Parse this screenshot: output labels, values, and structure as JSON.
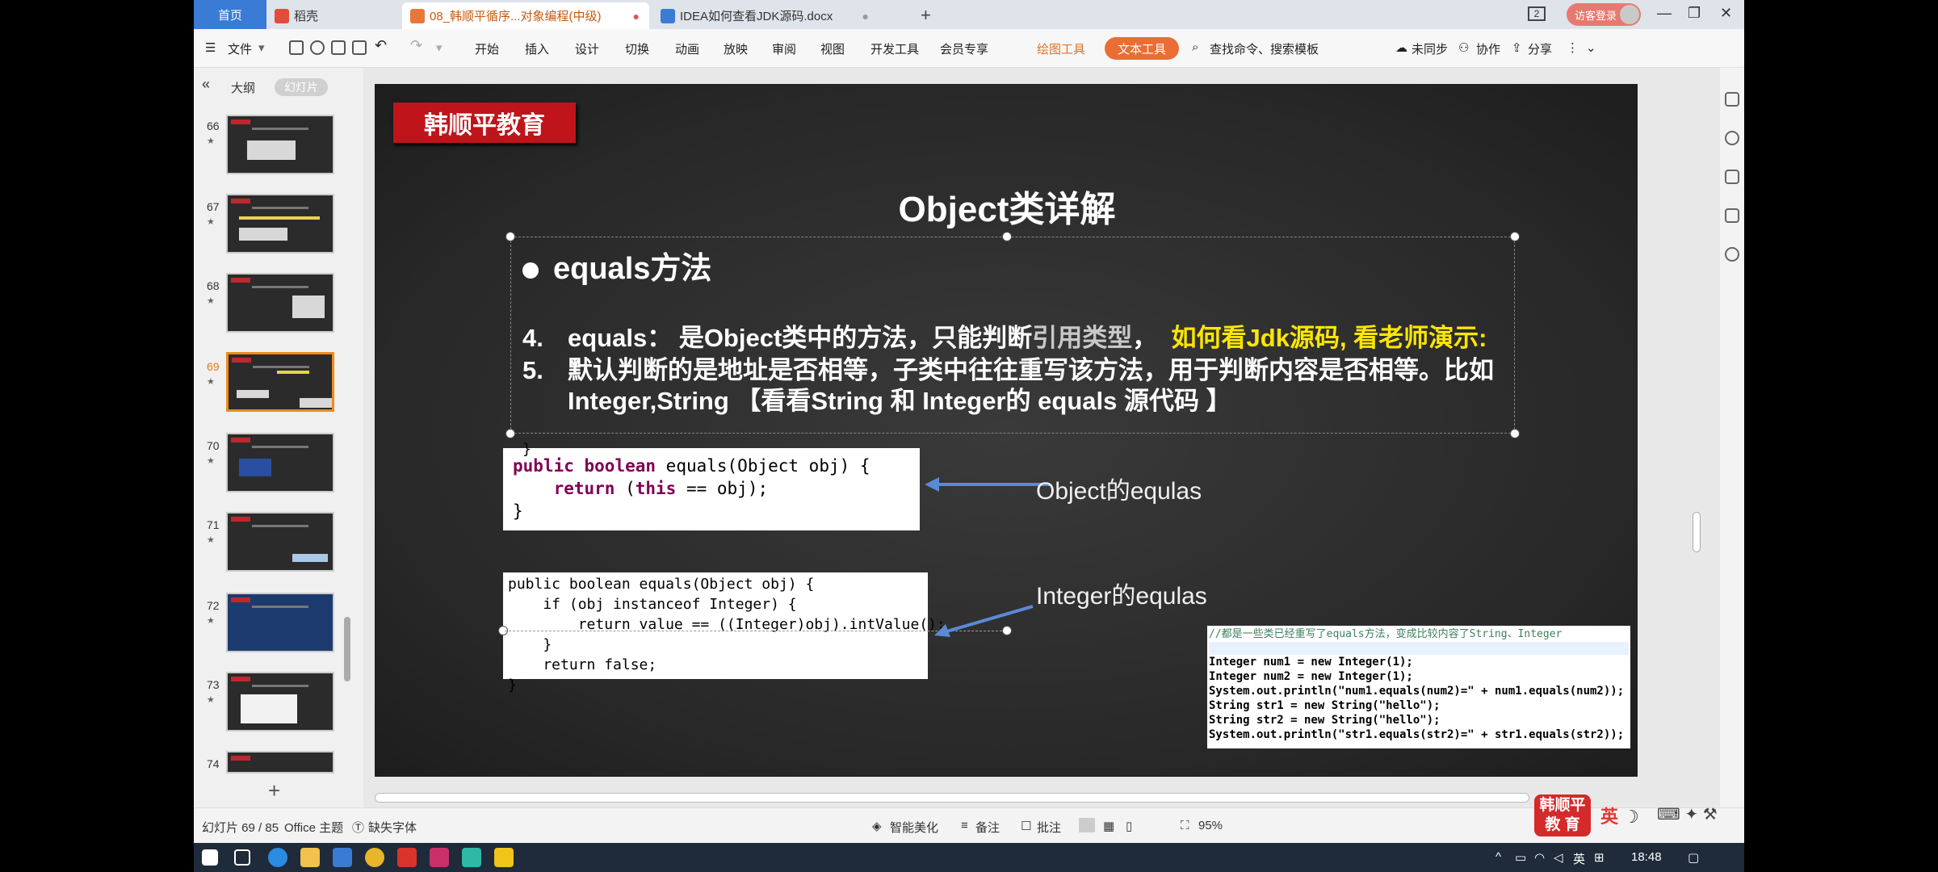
{
  "titlebar": {
    "tabs": [
      {
        "label": "首页"
      },
      {
        "label": "稻壳"
      },
      {
        "label": "08_韩顺平循序...对象编程(中级)"
      },
      {
        "label": "IDEA如何查看JDK源码.docx"
      }
    ],
    "window_count": "2",
    "login_label": "访客登录"
  },
  "menu": {
    "file": "文件",
    "items": [
      "开始",
      "插入",
      "设计",
      "切换",
      "动画",
      "放映",
      "审阅",
      "视图",
      "开发工具",
      "会员专享"
    ],
    "drawing_tool": "绘图工具",
    "text_tool": "文本工具",
    "search_placeholder": "查找命令、搜索模板",
    "sync": "未同步",
    "collab": "协作",
    "share": "分享"
  },
  "left_panel": {
    "outline_tab": "大纲",
    "slides_tab": "幻灯片",
    "thumbs": [
      {
        "num": "66"
      },
      {
        "num": "67"
      },
      {
        "num": "68"
      },
      {
        "num": "69"
      },
      {
        "num": "70"
      },
      {
        "num": "71"
      },
      {
        "num": "72"
      },
      {
        "num": "73"
      },
      {
        "num": "74"
      }
    ],
    "selected_index": 3
  },
  "slide": {
    "brand": "韩顺平教育",
    "title": "Object类详解",
    "bullet": "equals方法",
    "line4_num": "4.",
    "line4_a": "equals： 是Object类中的方法，只能判断",
    "line4_b": "引用类型",
    "line4_c": "，",
    "line4_d": "如何看Jdk源码, 看老师演示:",
    "line5_num": "5.",
    "line5_a": "默认判断的是地址是否相等，子类中往往重写该方法，用于判断内容是否相等。比如",
    "line5_b": "Integer,String 【看看String 和 Integer的 equals 源代码 】",
    "label_object": "Object的equlas",
    "label_integer": "Integer的equlas",
    "code1": {
      "l0": "}",
      "l1a": "public",
      "l1b": "boolean",
      "l1c": " equals(Object obj) {",
      "l2a": "return",
      "l2b": " (",
      "l2c": "this",
      "l2d": " == obj);",
      "l3": "}"
    },
    "code2": {
      "l1": "public boolean equals(Object obj) {",
      "l2": "    if (obj instanceof Integer) {",
      "l3": "        return value == ((Integer)obj).intValue();",
      "l4": "    }",
      "l5": "    return false;",
      "l6": "}"
    },
    "code3": {
      "l0": "//都是一些类已经重写了equals方法，变成比较内容了String、Integer",
      "l1": "Integer num1 = new Integer(1);",
      "l2": "Integer num2 = new Integer(1);",
      "l3": "System.out.println(\"num1.equals(num2)=\" + num1.equals(num2));",
      "l4": "String str1 = new String(\"hello\");",
      "l5": "String str2 = new String(\"hello\");",
      "l6": "System.out.println(\"str1.equals(str2)=\" + str1.equals(str2));"
    }
  },
  "status": {
    "slide_count": "幻灯片 69 / 85",
    "theme": "Office 主题",
    "missing_font": "缺失字体",
    "beautify": "智能美化",
    "notes": "备注",
    "comments": "批注",
    "zoom": "95%",
    "badge_top": "韩顺平",
    "badge_bottom": "教  育",
    "ime": "英"
  },
  "taskbar": {
    "ime": "英",
    "time": "18:48"
  },
  "colors": {
    "accent_orange": "#e96d35",
    "brand_red": "#c0141b",
    "slide_bg": "#2d2d2d",
    "highlight_yellow": "#ffe600"
  }
}
